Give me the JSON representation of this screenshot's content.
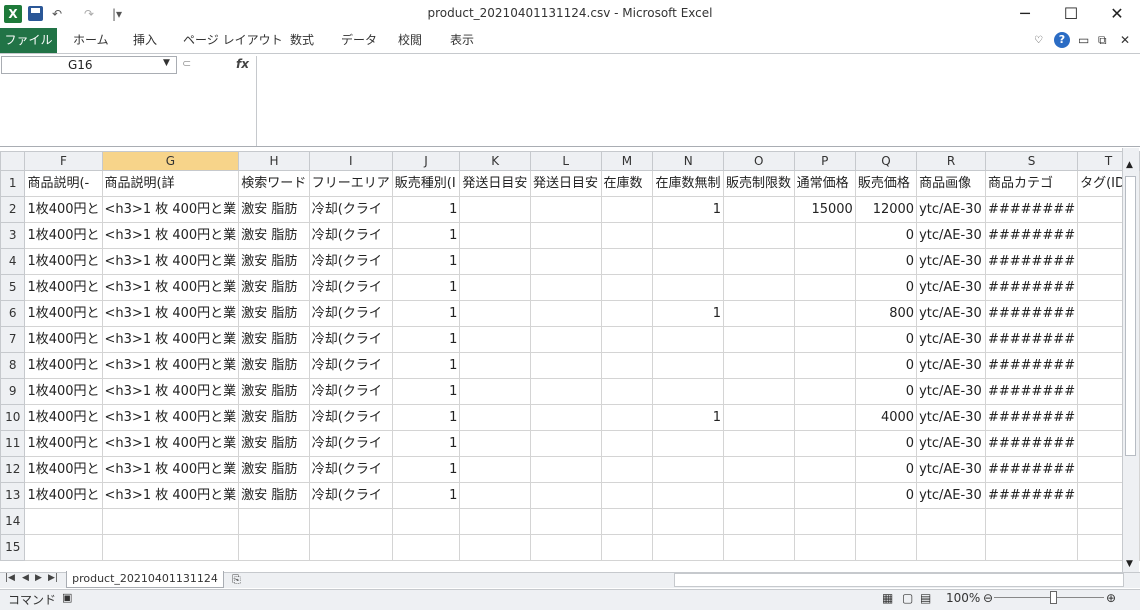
{
  "window": {
    "title": "product_20210401131124.csv  -  Microsoft Excel",
    "minimize": "─",
    "maximize": "☐",
    "close": "✕"
  },
  "quick_access": {
    "logo": "X",
    "undo": "↶",
    "redo": "↷",
    "customize": "|▾"
  },
  "ribbon": {
    "file": "ファイル",
    "tabs": [
      "ホーム",
      "挿入",
      "ページ レイアウト",
      "数式",
      "データ",
      "校閲",
      "表示"
    ]
  },
  "formula_bar": {
    "name_box": "G16",
    "fx": "fx",
    "value": ""
  },
  "columns": [
    "F",
    "G",
    "H",
    "I",
    "J",
    "K",
    "L",
    "M",
    "N",
    "O",
    "P",
    "Q",
    "R",
    "S",
    "T"
  ],
  "row_numbers": [
    "1",
    "2",
    "3",
    "4",
    "5",
    "6",
    "7",
    "8",
    "9",
    "10",
    "11",
    "12",
    "13",
    "14",
    "15"
  ],
  "header_row": [
    "商品説明(-",
    "商品説明(詳",
    "検索ワード",
    "フリーエリア",
    "販売種別(I",
    "発送日目安",
    "発送日目安",
    "在庫数",
    "在庫数無制",
    "販売制限数",
    "通常価格",
    "販売価格",
    "商品画像",
    "商品カテゴ",
    "タグ(ID)"
  ],
  "data_rows": [
    {
      "f": "1枚400円と",
      "g": "<h3>1 枚 400円と業",
      "h": "激安 脂肪",
      "i": "冷却(クライ",
      "j": "1",
      "n": "1",
      "p": "15000",
      "q": "12000",
      "r": "ytc/AE-30",
      "s": "########"
    },
    {
      "f": "1枚400円と",
      "g": "<h3>1 枚 400円と業",
      "h": "激安 脂肪",
      "i": "冷却(クライ",
      "j": "1",
      "n": "",
      "p": "",
      "q": "0",
      "r": "ytc/AE-30",
      "s": "########"
    },
    {
      "f": "1枚400円と",
      "g": "<h3>1 枚 400円と業",
      "h": "激安 脂肪",
      "i": "冷却(クライ",
      "j": "1",
      "n": "",
      "p": "",
      "q": "0",
      "r": "ytc/AE-30",
      "s": "########"
    },
    {
      "f": "1枚400円と",
      "g": "<h3>1 枚 400円と業",
      "h": "激安 脂肪",
      "i": "冷却(クライ",
      "j": "1",
      "n": "",
      "p": "",
      "q": "0",
      "r": "ytc/AE-30",
      "s": "########"
    },
    {
      "f": "1枚400円と",
      "g": "<h3>1 枚 400円と業",
      "h": "激安 脂肪",
      "i": "冷却(クライ",
      "j": "1",
      "n": "1",
      "p": "",
      "q": "800",
      "r": "ytc/AE-30",
      "s": "########"
    },
    {
      "f": "1枚400円と",
      "g": "<h3>1 枚 400円と業",
      "h": "激安 脂肪",
      "i": "冷却(クライ",
      "j": "1",
      "n": "",
      "p": "",
      "q": "0",
      "r": "ytc/AE-30",
      "s": "########"
    },
    {
      "f": "1枚400円と",
      "g": "<h3>1 枚 400円と業",
      "h": "激安 脂肪",
      "i": "冷却(クライ",
      "j": "1",
      "n": "",
      "p": "",
      "q": "0",
      "r": "ytc/AE-30",
      "s": "########"
    },
    {
      "f": "1枚400円と",
      "g": "<h3>1 枚 400円と業",
      "h": "激安 脂肪",
      "i": "冷却(クライ",
      "j": "1",
      "n": "",
      "p": "",
      "q": "0",
      "r": "ytc/AE-30",
      "s": "########"
    },
    {
      "f": "1枚400円と",
      "g": "<h3>1 枚 400円と業",
      "h": "激安 脂肪",
      "i": "冷却(クライ",
      "j": "1",
      "n": "1",
      "p": "",
      "q": "4000",
      "r": "ytc/AE-30",
      "s": "########"
    },
    {
      "f": "1枚400円と",
      "g": "<h3>1 枚 400円と業",
      "h": "激安 脂肪",
      "i": "冷却(クライ",
      "j": "1",
      "n": "",
      "p": "",
      "q": "0",
      "r": "ytc/AE-30",
      "s": "########"
    },
    {
      "f": "1枚400円と",
      "g": "<h3>1 枚 400円と業",
      "h": "激安 脂肪",
      "i": "冷却(クライ",
      "j": "1",
      "n": "",
      "p": "",
      "q": "0",
      "r": "ytc/AE-30",
      "s": "########"
    },
    {
      "f": "1枚400円と",
      "g": "<h3>1 枚 400円と業",
      "h": "激安 脂肪",
      "i": "冷却(クライ",
      "j": "1",
      "n": "",
      "p": "",
      "q": "0",
      "r": "ytc/AE-30",
      "s": "########"
    }
  ],
  "sheet_tab": "product_20210401131124",
  "status": {
    "mode": "コマンド",
    "zoom": "100%",
    "zoom_out": "⊖",
    "zoom_in": "⊕"
  },
  "colors": {
    "file_tab": "#217346",
    "selected_header": "#f7d48a",
    "header_bg": "#eef0f3"
  }
}
